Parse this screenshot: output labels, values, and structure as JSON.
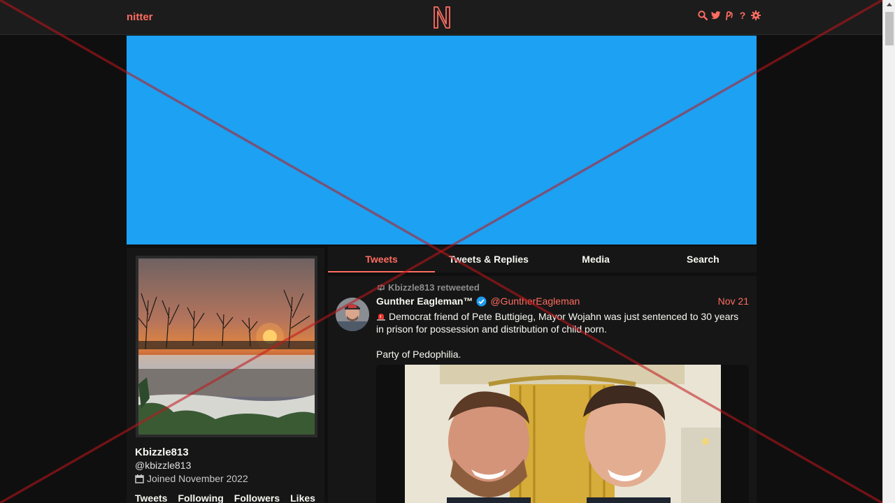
{
  "nav": {
    "brand": "nitter",
    "icons": [
      "search-icon",
      "twitter-bird-icon",
      "rss-icon",
      "help-icon",
      "gear-icon"
    ],
    "help_glyph": "?"
  },
  "colors": {
    "accent": "#ff6c60",
    "banner": "#1da1f2",
    "background": "#0f0f0f",
    "card": "#161616",
    "overlay_cross": "#c0161b"
  },
  "profile": {
    "fullname": "Kbizzle813",
    "username": "@kbizzle813",
    "joined": "Joined November 2022",
    "stats": [
      "Tweets",
      "Following",
      "Followers",
      "Likes"
    ]
  },
  "tabs": [
    {
      "label": "Tweets",
      "active": true
    },
    {
      "label": "Tweets & Replies",
      "active": false
    },
    {
      "label": "Media",
      "active": false
    },
    {
      "label": "Search",
      "active": false
    }
  ],
  "tweet": {
    "retweet_header": "Kbizzle813 retweeted",
    "fullname": "Gunther Eagleman™",
    "username": "@GuntherEagleman",
    "date": "Nov 21",
    "content": "Democrat friend of Pete Buttigieg, Mayor Wojahn was just sentenced to 30 years in prison for possession and distribution of child porn.\n\nParty of Pedophilia."
  }
}
